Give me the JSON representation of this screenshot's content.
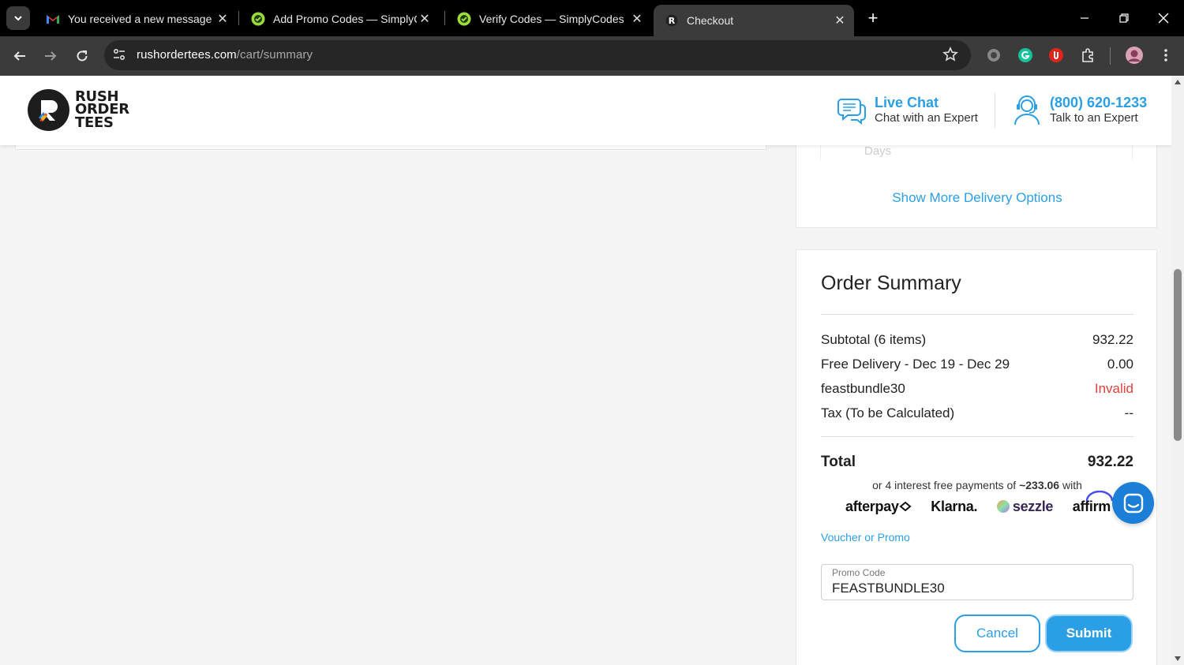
{
  "browser": {
    "tabs": [
      {
        "title": "You received a new message - ",
        "favicon": "gmail-icon"
      },
      {
        "title": "Add Promo Codes — SimplyCodes",
        "favicon": "simplycodes-icon"
      },
      {
        "title": "Verify Codes — SimplyCodes",
        "favicon": "simplycodes-icon"
      },
      {
        "title": "Checkout",
        "favicon": "rushordertees-icon",
        "active": true
      }
    ],
    "url_host": "rushordertees.com",
    "url_path": "/cart/summary"
  },
  "header": {
    "logo_lines": [
      "RUSH",
      "ORDER",
      "TEES"
    ],
    "live_chat": {
      "title": "Live Chat",
      "subtitle": "Chat with an Expert"
    },
    "phone": {
      "title": "(800) 620-1233",
      "subtitle": "Talk to an Expert"
    }
  },
  "delivery": {
    "partial_text": "Days",
    "show_more_label": "Show More Delivery Options"
  },
  "summary": {
    "heading": "Order Summary",
    "rows": [
      {
        "label": "Subtotal (6 items)",
        "value": "932.22"
      },
      {
        "label": "Free Delivery - Dec 19 - Dec 29",
        "value": "0.00"
      },
      {
        "label": "feastbundle30",
        "value": "Invalid"
      },
      {
        "label": "Tax (To be Calculated)",
        "value": "--"
      }
    ],
    "total_label": "Total",
    "total_value": "932.22",
    "installments_prefix": "or 4 interest free payments of ",
    "installments_amount": "~233.06",
    "installments_suffix": " with",
    "providers": [
      "afterpay",
      "Klarna.",
      "sezzle",
      "affirm"
    ],
    "voucher_label": "Voucher or Promo",
    "promo_field_label": "Promo Code",
    "promo_value": "FEASTBUNDLE30",
    "cancel_label": "Cancel",
    "submit_label": "Submit"
  },
  "colors": {
    "accent": "#2b9fe6",
    "invalid": "#e0413a"
  }
}
